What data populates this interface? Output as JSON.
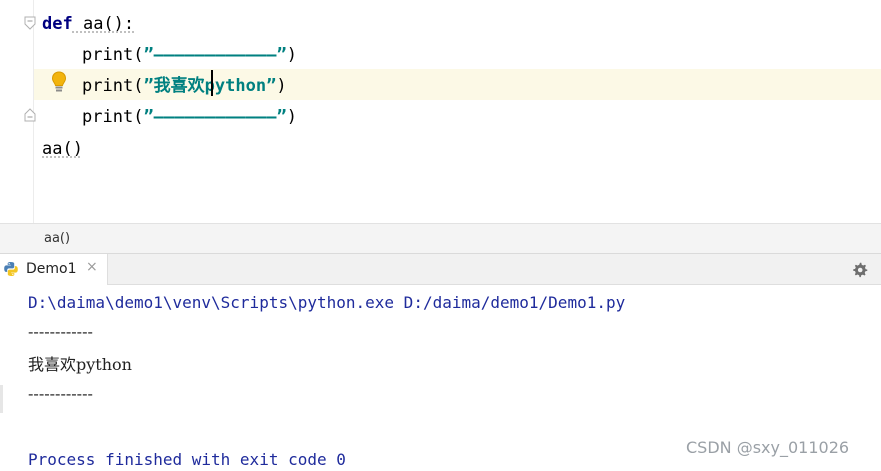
{
  "editor": {
    "lines": [
      {
        "kw": "def",
        "rest": " aa():"
      },
      {
        "fn": "print",
        "open": "(",
        "str": "”————————————”",
        "close": ")"
      },
      {
        "fn": "print",
        "open": "(",
        "str": "”我喜欢python”",
        "close": ")"
      },
      {
        "fn": "print",
        "open": "(",
        "str": "”————————————”",
        "close": ")"
      },
      {
        "call": "aa()"
      }
    ],
    "colors": {
      "keyword": "#000080",
      "string": "#008080",
      "current_line": "#fcf9e6"
    }
  },
  "breadcrumb": {
    "text": "aa()"
  },
  "run_panel": {
    "tab_label": "Demo1",
    "tab_close": "×",
    "icons": {
      "tab": "python-icon",
      "settings": "gear-icon"
    }
  },
  "console": {
    "command": "D:\\daima\\demo1\\venv\\Scripts\\python.exe D:/daima/demo1/Demo1.py",
    "out1": "------------",
    "out2": "我喜欢python",
    "out3": "------------",
    "process": "Process finished with exit code 0",
    "colors": {
      "system": "#1f2b9c",
      "output": "#222222"
    }
  },
  "watermark": "CSDN @sxy_011026"
}
